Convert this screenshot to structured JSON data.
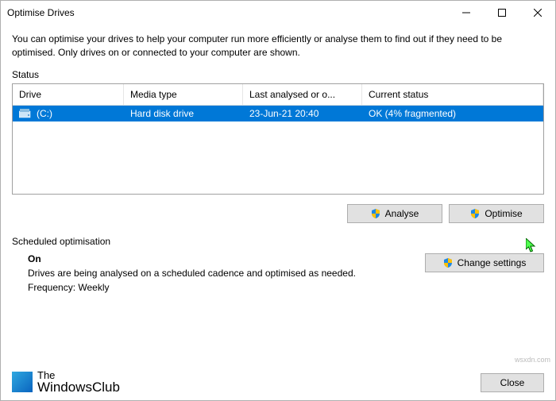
{
  "window": {
    "title": "Optimise Drives",
    "description": "You can optimise your drives to help your computer run more efficiently or analyse them to find out if they need to be optimised. Only drives on or connected to your computer are shown."
  },
  "status": {
    "label": "Status",
    "columns": {
      "drive": "Drive",
      "media": "Media type",
      "last": "Last analysed or o...",
      "current": "Current status"
    },
    "rows": [
      {
        "drive": "(C:)",
        "media": "Hard disk drive",
        "last": "23-Jun-21 20:40",
        "current": "OK (4% fragmented)"
      }
    ]
  },
  "buttons": {
    "analyse": "Analyse",
    "optimise": "Optimise",
    "change": "Change settings",
    "close": "Close"
  },
  "scheduled": {
    "label": "Scheduled optimisation",
    "state": "On",
    "desc": "Drives are being analysed on a scheduled cadence and optimised as needed.",
    "freq": "Frequency: Weekly"
  },
  "branding": {
    "line1": "The",
    "line2": "WindowsClub"
  },
  "watermark": "wsxdn.com"
}
